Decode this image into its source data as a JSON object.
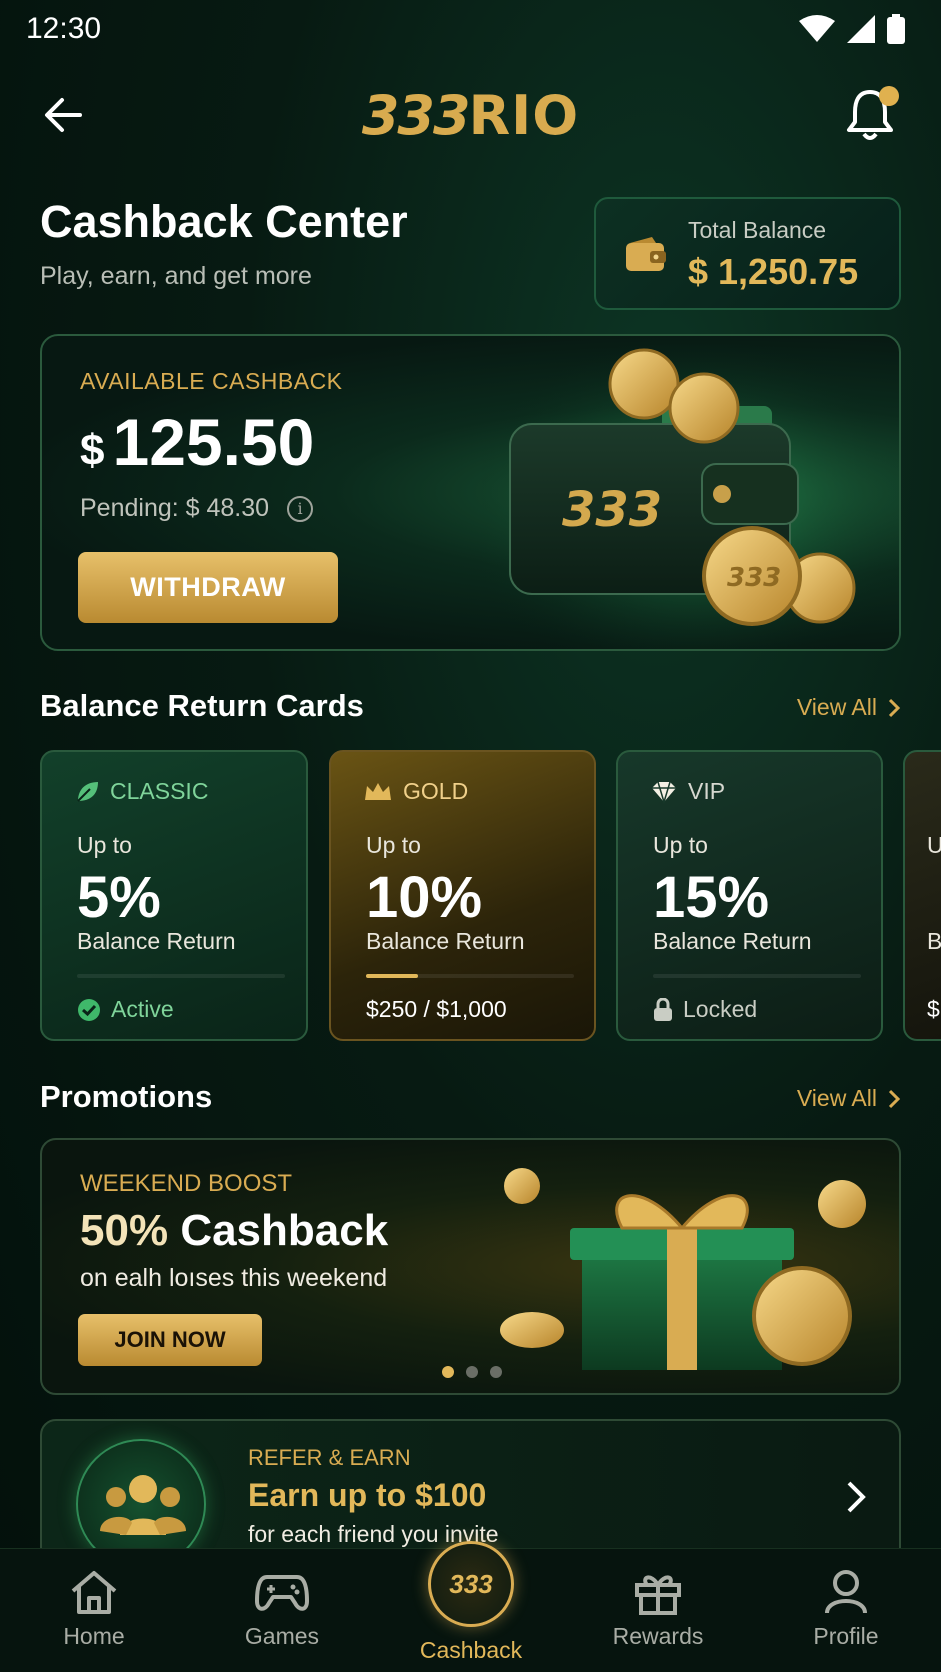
{
  "status_bar": {
    "time": "12:30"
  },
  "header": {
    "logo_a": "333",
    "logo_b": "RIO"
  },
  "page": {
    "title": "Cashback Center",
    "subtitle": "Play, earn, and get more"
  },
  "total_balance": {
    "label": "Total Balance",
    "value": "$ 1,250.75"
  },
  "cashback": {
    "label": "AVAILABLE CASHBACK",
    "currency": "$",
    "amount": "125.50",
    "pending": "Pending: $ 48.30",
    "withdraw_label": "WITHDRAW",
    "wallet_brand": "333",
    "coin_brand": "333"
  },
  "balance_cards": {
    "title": "Balance Return Cards",
    "view_all": "View All",
    "cards": [
      {
        "tier": "CLASSIC",
        "upto": "Up to",
        "pct": "5%",
        "desc": "Balance Return",
        "footer": "Active",
        "progress": 0
      },
      {
        "tier": "GOLD",
        "upto": "Up to",
        "pct": "10%",
        "desc": "Balance Return",
        "footer": "$250 / $1,000",
        "progress": 0.25
      },
      {
        "tier": "VIP",
        "upto": "Up to",
        "pct": "15%",
        "desc": "Balance Return",
        "footer": "Locked",
        "progress": 0
      }
    ],
    "partial_card": {
      "upto": "U",
      "pct": "",
      "desc": "B",
      "footer": "$"
    }
  },
  "promotions": {
    "title": "Promotions",
    "view_all": "View All",
    "label": "WEEKEND BOOST",
    "headline_a": "50%",
    "headline_b": "Cashback",
    "sub": "on ealh loıses this weekend",
    "join_label": "JOIN NOW",
    "active_slide": 1,
    "slide_count": 3
  },
  "refer": {
    "label": "REFER & EARN",
    "headline": "Earn up to $100",
    "sub": "for each friend you invite"
  },
  "nav": {
    "items": [
      "Home",
      "Games",
      "Cashback",
      "Rewards",
      "Profile"
    ],
    "center_badge": "333"
  },
  "colors": {
    "gold": "#e2b85a",
    "bg": "#04120d",
    "green_border": "#2a5a3d",
    "active_green": "#5fcf7d"
  },
  "icons": [
    "back-arrow-icon",
    "bell-icon",
    "wallet-icon",
    "info-icon",
    "leaf-icon",
    "crown-icon",
    "diamond-icon",
    "check-circle-icon",
    "lock-icon",
    "chevron-right-icon",
    "users-icon",
    "home-icon",
    "gamepad-icon",
    "gift-icon",
    "user-icon"
  ]
}
